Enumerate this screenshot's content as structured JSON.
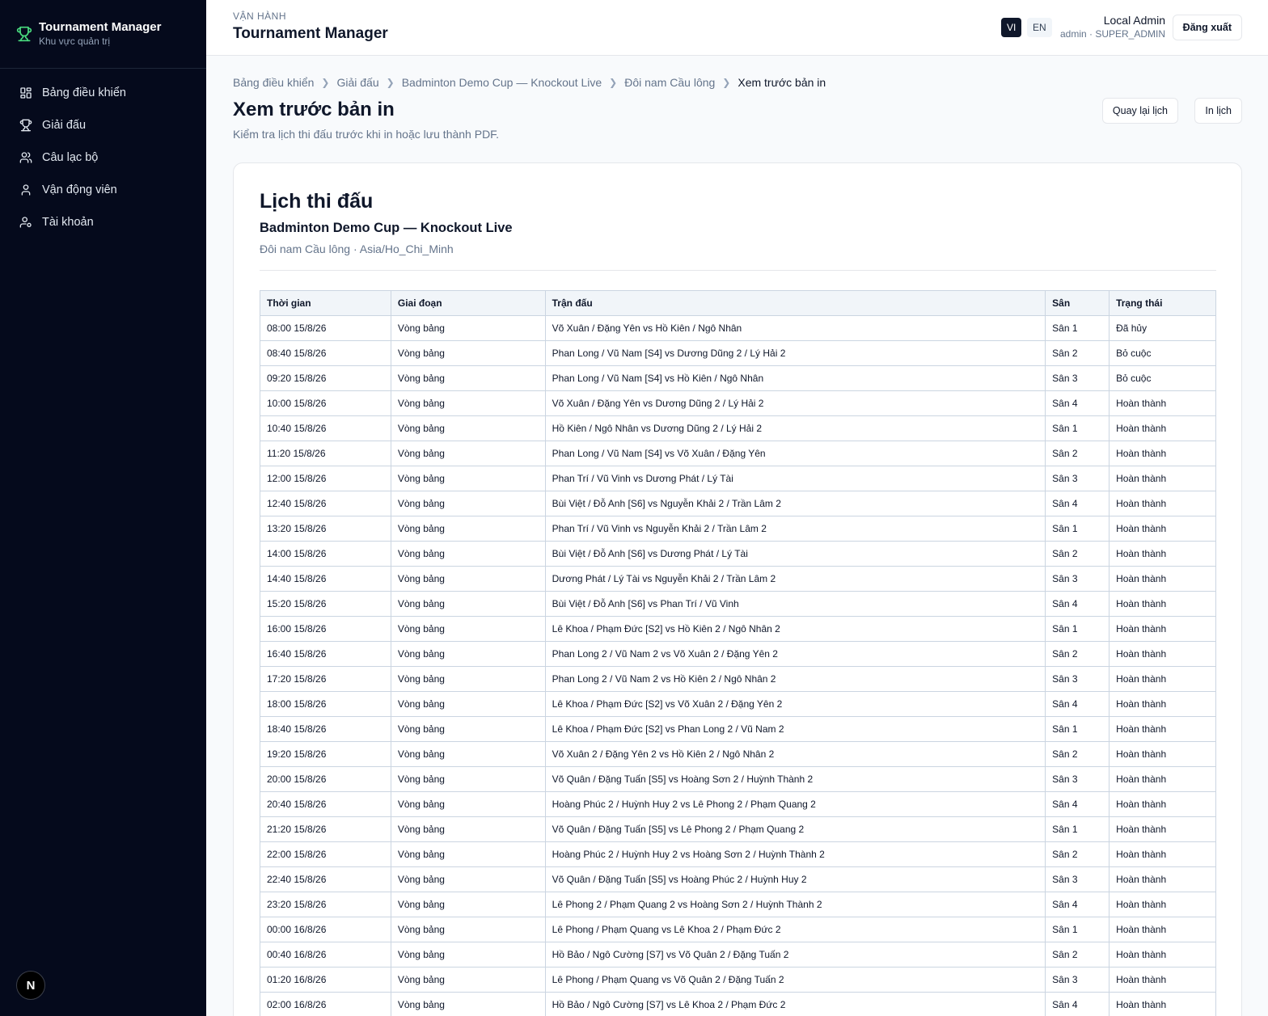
{
  "sidebar": {
    "brand_title": "Tournament Manager",
    "brand_subtitle": "Khu vực quản trị",
    "items": [
      {
        "label": "Bảng điều khiển",
        "icon": "dashboard-icon"
      },
      {
        "label": "Giải đấu",
        "icon": "trophy-icon"
      },
      {
        "label": "Câu lạc bộ",
        "icon": "users-icon"
      },
      {
        "label": "Vận động viên",
        "icon": "user-icon"
      },
      {
        "label": "Tài khoản",
        "icon": "user-cog-icon"
      }
    ],
    "badge": "N"
  },
  "header": {
    "eyebrow": "VẬN HÀNH",
    "title": "Tournament Manager",
    "lang_vi": "VI",
    "lang_en": "EN",
    "user_name": "Local Admin",
    "user_role": "admin · SUPER_ADMIN",
    "logout": "Đăng xuất"
  },
  "breadcrumb": [
    "Bảng điều khiển",
    "Giải đấu",
    "Badminton Demo Cup — Knockout Live",
    "Đôi nam Cầu lông",
    "Xem trước bản in"
  ],
  "page": {
    "title": "Xem trước bản in",
    "description": "Kiểm tra lịch thi đấu trước khi in hoặc lưu thành PDF.",
    "back_button": "Quay lại lịch",
    "print_button": "In lịch"
  },
  "schedule": {
    "title": "Lịch thi đấu",
    "tournament": "Badminton Demo Cup — Knockout Live",
    "meta": "Đôi nam Cầu lông · Asia/Ho_Chi_Minh",
    "columns": [
      "Thời gian",
      "Giai đoạn",
      "Trận đấu",
      "Sân",
      "Trạng thái"
    ],
    "rows": [
      [
        "08:00 15/8/26",
        "Vòng bảng",
        "Võ Xuân / Đặng Yên vs Hồ Kiên / Ngô Nhân",
        "Sân 1",
        "Đã hủy"
      ],
      [
        "08:40 15/8/26",
        "Vòng bảng",
        "Phan Long / Vũ Nam [S4] vs Dương Dũng 2 / Lý Hải 2",
        "Sân 2",
        "Bỏ cuộc"
      ],
      [
        "09:20 15/8/26",
        "Vòng bảng",
        "Phan Long / Vũ Nam [S4] vs Hồ Kiên / Ngô Nhân",
        "Sân 3",
        "Bỏ cuộc"
      ],
      [
        "10:00 15/8/26",
        "Vòng bảng",
        "Võ Xuân / Đặng Yên vs Dương Dũng 2 / Lý Hải 2",
        "Sân 4",
        "Hoàn thành"
      ],
      [
        "10:40 15/8/26",
        "Vòng bảng",
        "Hồ Kiên / Ngô Nhân vs Dương Dũng 2 / Lý Hải 2",
        "Sân 1",
        "Hoàn thành"
      ],
      [
        "11:20 15/8/26",
        "Vòng bảng",
        "Phan Long / Vũ Nam [S4] vs Võ Xuân / Đặng Yên",
        "Sân 2",
        "Hoàn thành"
      ],
      [
        "12:00 15/8/26",
        "Vòng bảng",
        "Phan Trí / Vũ Vinh vs Dương Phát / Lý Tài",
        "Sân 3",
        "Hoàn thành"
      ],
      [
        "12:40 15/8/26",
        "Vòng bảng",
        "Bùi Việt / Đỗ Anh [S6] vs Nguyễn Khải 2 / Trần Lâm 2",
        "Sân 4",
        "Hoàn thành"
      ],
      [
        "13:20 15/8/26",
        "Vòng bảng",
        "Phan Trí / Vũ Vinh vs Nguyễn Khải 2 / Trần Lâm 2",
        "Sân 1",
        "Hoàn thành"
      ],
      [
        "14:00 15/8/26",
        "Vòng bảng",
        "Bùi Việt / Đỗ Anh [S6] vs Dương Phát / Lý Tài",
        "Sân 2",
        "Hoàn thành"
      ],
      [
        "14:40 15/8/26",
        "Vòng bảng",
        "Dương Phát / Lý Tài vs Nguyễn Khải 2 / Trần Lâm 2",
        "Sân 3",
        "Hoàn thành"
      ],
      [
        "15:20 15/8/26",
        "Vòng bảng",
        "Bùi Việt / Đỗ Anh [S6] vs Phan Trí / Vũ Vinh",
        "Sân 4",
        "Hoàn thành"
      ],
      [
        "16:00 15/8/26",
        "Vòng bảng",
        "Lê Khoa / Phạm Đức [S2] vs Hồ Kiên 2 / Ngô Nhân 2",
        "Sân 1",
        "Hoàn thành"
      ],
      [
        "16:40 15/8/26",
        "Vòng bảng",
        "Phan Long 2 / Vũ Nam 2 vs Võ Xuân 2 / Đặng Yên 2",
        "Sân 2",
        "Hoàn thành"
      ],
      [
        "17:20 15/8/26",
        "Vòng bảng",
        "Phan Long 2 / Vũ Nam 2 vs Hồ Kiên 2 / Ngô Nhân 2",
        "Sân 3",
        "Hoàn thành"
      ],
      [
        "18:00 15/8/26",
        "Vòng bảng",
        "Lê Khoa / Phạm Đức [S2] vs Võ Xuân 2 / Đặng Yên 2",
        "Sân 4",
        "Hoàn thành"
      ],
      [
        "18:40 15/8/26",
        "Vòng bảng",
        "Lê Khoa / Phạm Đức [S2] vs Phan Long 2 / Vũ Nam 2",
        "Sân 1",
        "Hoàn thành"
      ],
      [
        "19:20 15/8/26",
        "Vòng bảng",
        "Võ Xuân 2 / Đặng Yên 2 vs Hồ Kiên 2 / Ngô Nhân 2",
        "Sân 2",
        "Hoàn thành"
      ],
      [
        "20:00 15/8/26",
        "Vòng bảng",
        "Võ Quân / Đặng Tuấn [S5] vs Hoàng Sơn 2 / Huỳnh Thành 2",
        "Sân 3",
        "Hoàn thành"
      ],
      [
        "20:40 15/8/26",
        "Vòng bảng",
        "Hoàng Phúc 2 / Huỳnh Huy 2 vs Lê Phong 2 / Phạm Quang 2",
        "Sân 4",
        "Hoàn thành"
      ],
      [
        "21:20 15/8/26",
        "Vòng bảng",
        "Võ Quân / Đặng Tuấn [S5] vs Lê Phong 2 / Phạm Quang 2",
        "Sân 1",
        "Hoàn thành"
      ],
      [
        "22:00 15/8/26",
        "Vòng bảng",
        "Hoàng Phúc 2 / Huỳnh Huy 2 vs Hoàng Sơn 2 / Huỳnh Thành 2",
        "Sân 2",
        "Hoàn thành"
      ],
      [
        "22:40 15/8/26",
        "Vòng bảng",
        "Võ Quân / Đặng Tuấn [S5] vs Hoàng Phúc 2 / Huỳnh Huy 2",
        "Sân 3",
        "Hoàn thành"
      ],
      [
        "23:20 15/8/26",
        "Vòng bảng",
        "Lê Phong 2 / Phạm Quang 2 vs Hoàng Sơn 2 / Huỳnh Thành 2",
        "Sân 4",
        "Hoàn thành"
      ],
      [
        "00:00 16/8/26",
        "Vòng bảng",
        "Lê Phong / Phạm Quang vs Lê Khoa 2 / Phạm Đức 2",
        "Sân 1",
        "Hoàn thành"
      ],
      [
        "00:40 16/8/26",
        "Vòng bảng",
        "Hồ Bảo / Ngô Cường [S7] vs Võ Quân 2 / Đặng Tuấn 2",
        "Sân 2",
        "Hoàn thành"
      ],
      [
        "01:20 16/8/26",
        "Vòng bảng",
        "Lê Phong / Phạm Quang vs Võ Quân 2 / Đặng Tuấn 2",
        "Sân 3",
        "Hoàn thành"
      ],
      [
        "02:00 16/8/26",
        "Vòng bảng",
        "Hồ Bảo / Ngô Cường [S7] vs Lê Khoa 2 / Phạm Đức 2",
        "Sân 4",
        "Hoàn thành"
      ]
    ]
  },
  "colors": {
    "sidebar_bg": "#050a1c",
    "brand_accent": "#4ade80",
    "primary": "#0f172a"
  }
}
